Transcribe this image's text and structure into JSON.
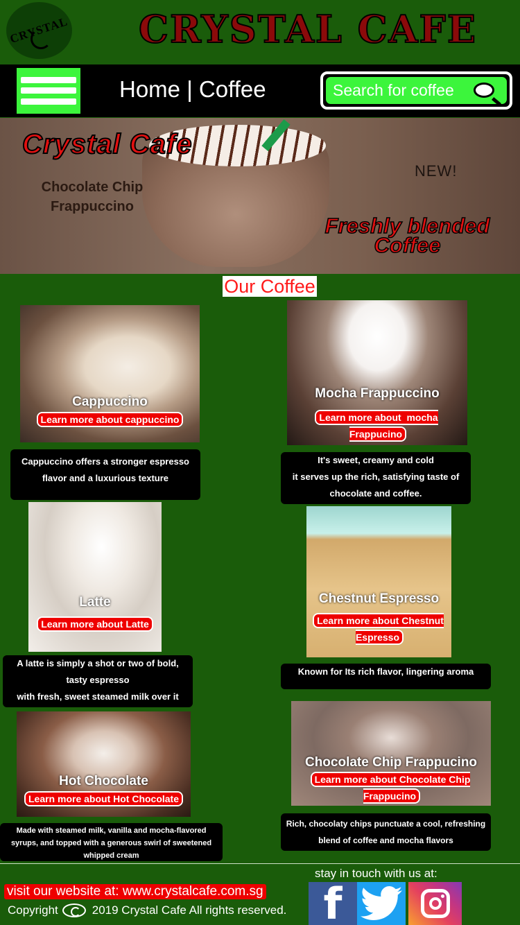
{
  "header": {
    "logo_text": "CRYSTAL",
    "title": "CRYSTAL CAFE"
  },
  "nav": {
    "breadcrumb": "Home | Coffee",
    "search_placeholder": "Search for coffee"
  },
  "hero": {
    "brand": "Crystal Cafe",
    "product": "Chocolate Chip Frappuccino",
    "badge": "NEW!",
    "tagline": "Freshly blended Coffee"
  },
  "section_title": "Our Coffee",
  "products": {
    "cappuccino": {
      "name": "Cappuccino",
      "link": "Learn more about cappuccino",
      "description": "Cappuccino offers a stronger espresso\nflavor and a luxurious texture"
    },
    "mocha": {
      "name": "Mocha Frappuccino",
      "link": "Learn more about  mocha\nFrappucino",
      "description": "It's sweet, creamy and cold\nit serves up the rich, satisfying taste of\nchocolate and coffee."
    },
    "latte": {
      "name": "Latte",
      "link": "Learn more about Latte",
      "description": "A latte is simply a shot or two of bold,\ntasty espresso\nwith fresh, sweet steamed milk over it"
    },
    "chestnut": {
      "name": "Chestnut Espresso",
      "link": "Learn more about Chestnut\nEspresso",
      "description": "Known for Its rich flavor, lingering aroma"
    },
    "hot_chocolate": {
      "name": "Hot Chocolate",
      "link": "Learn more about Hot  Chocolate",
      "description": "Made with steamed milk, vanilla and mocha-flavored\nsyrups, and topped with a generous swirl of sweetened\nwhipped cream"
    },
    "chocolate_chip": {
      "name": "Chocolate Chip Frappucino",
      "link": "Learn more about Chocolate Chip\nFrappucino",
      "description": "Rich, chocolaty chips punctuate a cool, refreshing\nblend of coffee and mocha flavors"
    }
  },
  "footer": {
    "stay_in_touch": "stay in touch with us at:",
    "website": "visit our website at: www.crystalcafe.com.sg",
    "copyright_prefix": "Copyright",
    "copyright_text": "2019 Crystal Cafe All rights reserved.",
    "social": [
      "facebook",
      "twitter",
      "instagram"
    ]
  },
  "colors": {
    "background": "#1a5c0a",
    "accent": "#e00000",
    "search_green": "#3cf53c"
  }
}
